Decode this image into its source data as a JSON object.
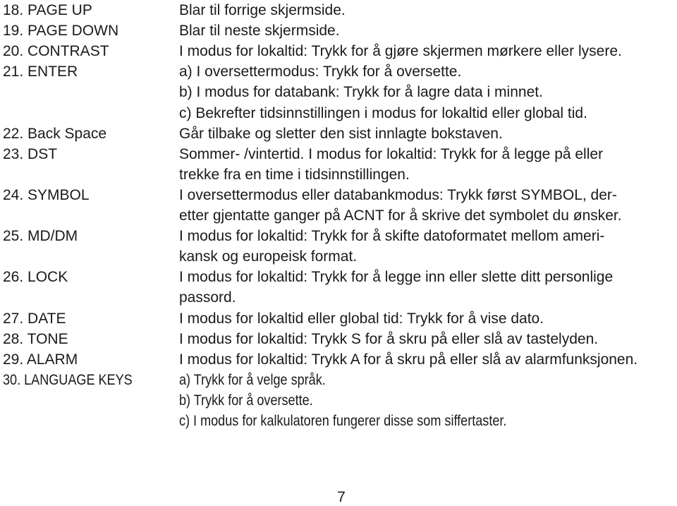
{
  "entries": [
    {
      "key": "18. PAGE UP",
      "lines": [
        "Blar til forrige skjermside."
      ]
    },
    {
      "key": "19. PAGE DOWN",
      "lines": [
        "Blar til neste skjermside."
      ]
    },
    {
      "key": "20. CONTRAST",
      "lines": [
        "I modus for lokaltid: Trykk for å gjøre skjermen mørkere eller lysere."
      ]
    },
    {
      "key": "21. ENTER",
      "lines": [
        "a) I oversettermodus: Trykk for å oversette.",
        "b) I modus for databank: Trykk for å lagre data i minnet.",
        "c) Bekrefter tidsinnstillingen i modus for lokaltid eller global tid."
      ]
    },
    {
      "key": "22. Back Space",
      "lines": [
        "Går tilbake og sletter den sist innlagte bokstaven."
      ]
    },
    {
      "key": "23. DST",
      "lines": [
        "Sommer- /vintertid. I modus for lokaltid: Trykk for å legge på eller",
        "trekke fra en time i tidsinnstillingen."
      ]
    },
    {
      "key": "24. SYMBOL",
      "lines": [
        "I oversettermodus eller databankmodus: Trykk først SYMBOL, der-",
        "etter gjentatte ganger på ACNT for å skrive det symbolet du ønsker."
      ]
    },
    {
      "key": "25. MD/DM",
      "lines": [
        "I modus for lokaltid: Trykk for å skifte datoformatet mellom ameri-",
        "kansk og europeisk format."
      ]
    },
    {
      "key": "26. LOCK",
      "lines": [
        "I modus for lokaltid: Trykk for å legge inn eller slette ditt personlige",
        "passord."
      ]
    },
    {
      "key": "27. DATE",
      "lines": [
        "I modus for lokaltid eller global tid: Trykk for å vise dato."
      ]
    },
    {
      "key": "28. TONE",
      "lines": [
        "I modus for lokaltid: Trykk S for å skru på eller slå av tastelyden."
      ]
    },
    {
      "key": "29. ALARM",
      "lines": [
        "I modus for lokaltid: Trykk A for å skru på eller slå av alarmfunksjonen."
      ]
    },
    {
      "key": "30. LANGUAGE KEYS",
      "lines": [
        "a) Trykk for å velge språk.",
        "b) Trykk for å oversette.",
        "c) I modus for kalkulatoren fungerer disse som siffertaster."
      ]
    }
  ],
  "page_number": "7"
}
